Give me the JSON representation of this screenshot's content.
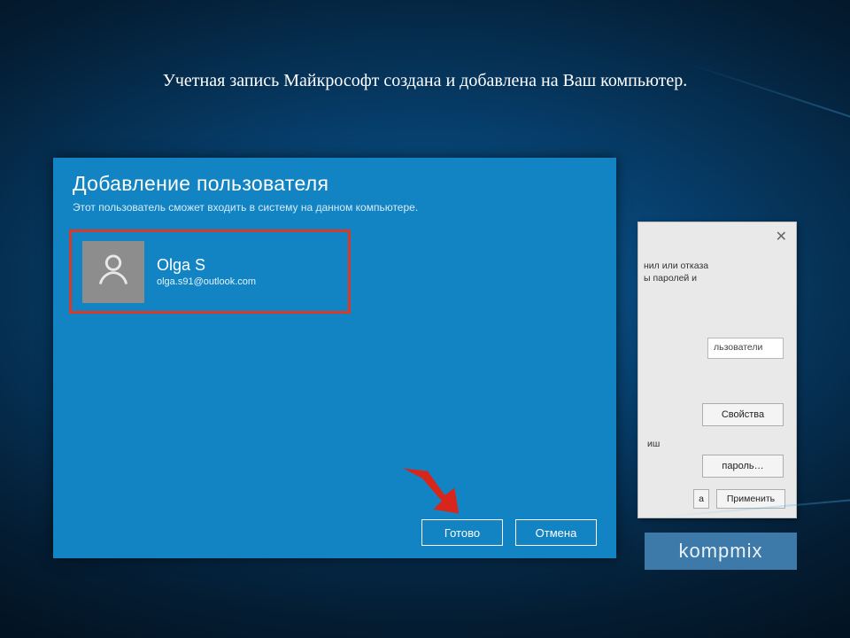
{
  "caption": "Учетная запись Майкрософт создана и добавлена на Ваш компьютер.",
  "panel": {
    "title": "Добавление пользователя",
    "subtitle": "Этот пользователь сможет входить в систему на данном компьютере.",
    "user": {
      "name": "Olga S",
      "email": "olga.s91@outlook.com"
    },
    "buttons": {
      "done": "Готово",
      "cancel": "Отмена"
    }
  },
  "bg_dialog": {
    "fragment1_line1": "нил или отказа",
    "fragment1_line2": "ы паролей и",
    "field_users": "льзователи",
    "btn_properties": "Свойства",
    "fragment2": "иш",
    "btn_password": "пароль…",
    "btn_apply": "Применить",
    "btn_a": "а"
  },
  "watermark": "kompmix"
}
